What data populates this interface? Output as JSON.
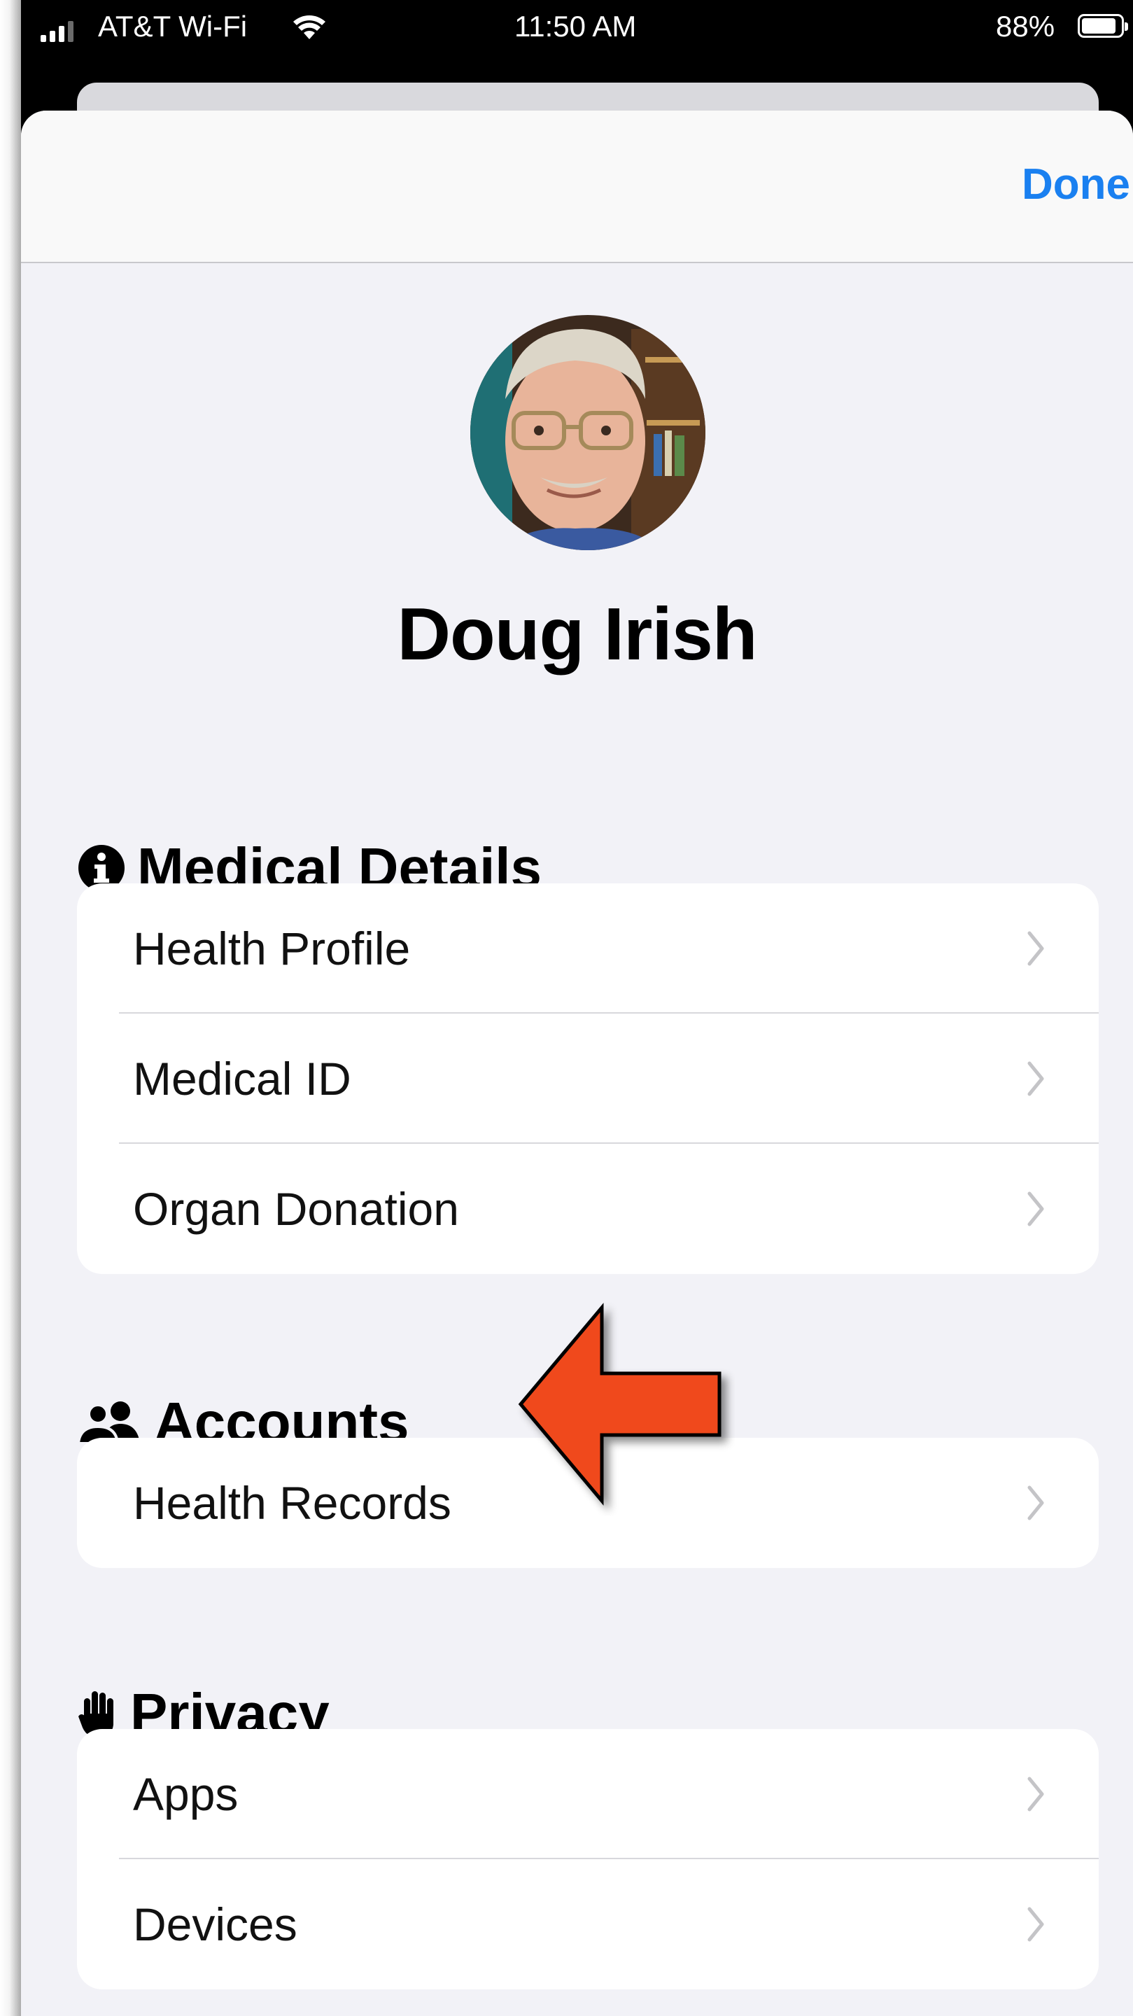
{
  "status_bar": {
    "carrier": "AT&T Wi-Fi",
    "time": "11:50 AM",
    "battery": "88%",
    "battery_level": 0.88
  },
  "nav": {
    "done_label": "Done"
  },
  "profile": {
    "name": "Doug Irish"
  },
  "sections": {
    "medical": {
      "title": "Medical Details",
      "icon": "info-circle-icon",
      "items": [
        {
          "label": "Health Profile"
        },
        {
          "label": "Medical ID"
        },
        {
          "label": "Organ Donation"
        }
      ]
    },
    "accounts": {
      "title": "Accounts",
      "icon": "people-icon",
      "items": [
        {
          "label": "Health Records"
        }
      ]
    },
    "privacy": {
      "title": "Privacy",
      "icon": "hand-icon",
      "items": [
        {
          "label": "Apps"
        },
        {
          "label": "Devices"
        }
      ]
    }
  },
  "annotation": {
    "icon": "red-pointer-arrow-icon",
    "color": "#f04a1a"
  },
  "colors": {
    "accent": "#1a80f0",
    "background": "#f2f2f7"
  }
}
